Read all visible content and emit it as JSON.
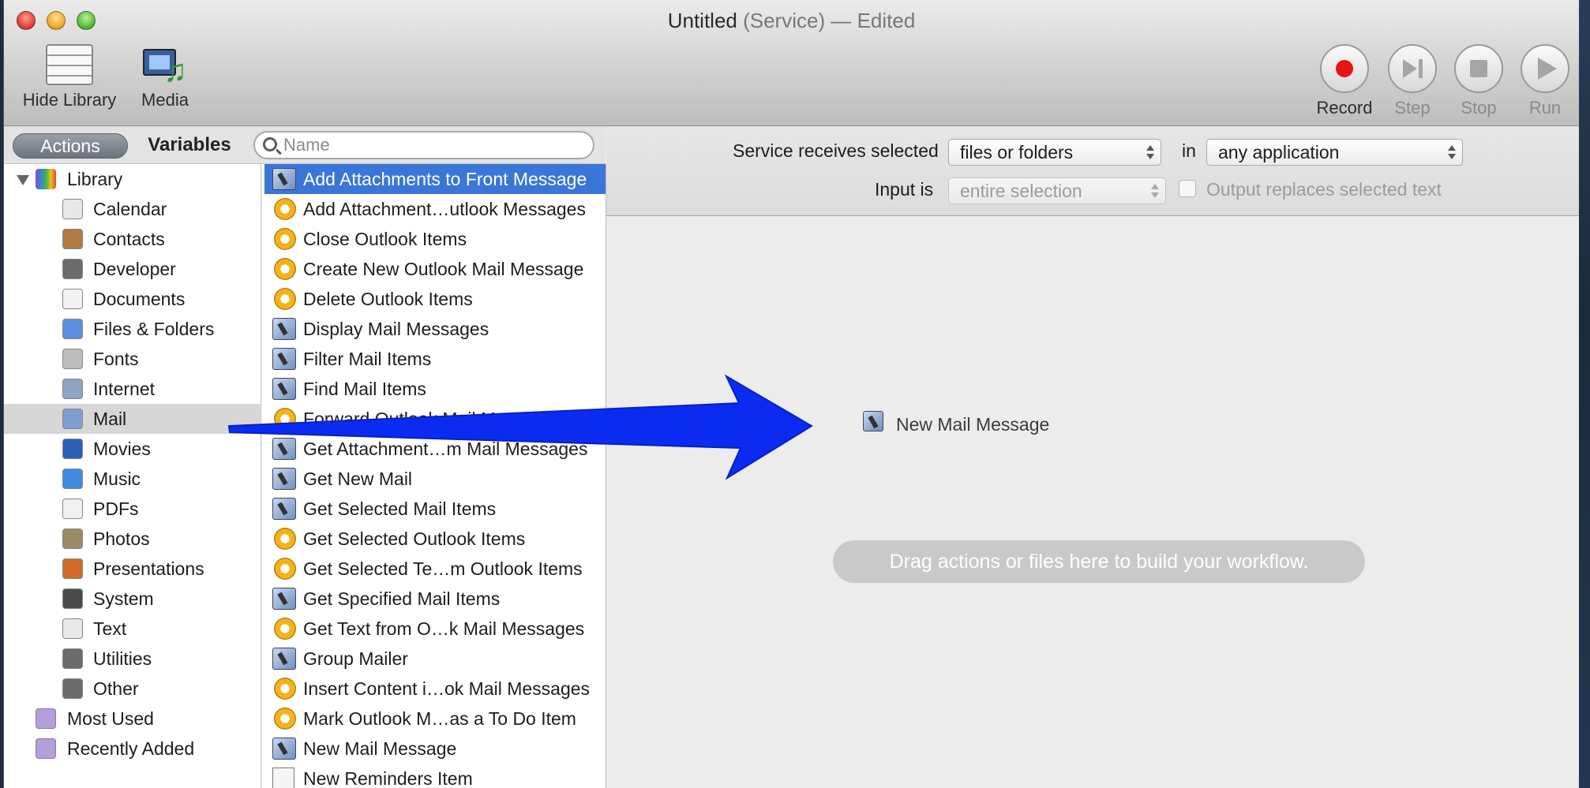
{
  "window": {
    "title_main": "Untitled",
    "title_type": "(Service)",
    "title_state": "— Edited"
  },
  "toolbar": {
    "hide_library": "Hide Library",
    "media": "Media",
    "record": "Record",
    "step": "Step",
    "stop": "Stop",
    "run": "Run"
  },
  "library_header": {
    "actions": "Actions",
    "variables": "Variables",
    "search_placeholder": "Name"
  },
  "library": {
    "root": "Library",
    "categories": [
      "Calendar",
      "Contacts",
      "Developer",
      "Documents",
      "Files & Folders",
      "Fonts",
      "Internet",
      "Mail",
      "Movies",
      "Music",
      "PDFs",
      "Photos",
      "Presentations",
      "System",
      "Text",
      "Utilities",
      "Other"
    ],
    "selected_category": "Mail",
    "most_used": "Most Used",
    "recently_added": "Recently Added"
  },
  "actions": [
    {
      "label": "Add Attachments to Front Message",
      "icon": "mail-icon"
    },
    {
      "label": "Add Attachment…utlook Messages",
      "icon": "outlook-icon"
    },
    {
      "label": "Close Outlook Items",
      "icon": "outlook-icon"
    },
    {
      "label": "Create New Outlook Mail Message",
      "icon": "outlook-icon"
    },
    {
      "label": "Delete Outlook Items",
      "icon": "outlook-icon"
    },
    {
      "label": "Display Mail Messages",
      "icon": "mail-icon"
    },
    {
      "label": "Filter Mail Items",
      "icon": "mail-icon"
    },
    {
      "label": "Find Mail Items",
      "icon": "mail-icon"
    },
    {
      "label": "Forward Outlook Mail Messages",
      "icon": "outlook-icon"
    },
    {
      "label": "Get Attachment…m Mail Messages",
      "icon": "mail-icon"
    },
    {
      "label": "Get New Mail",
      "icon": "mail-icon"
    },
    {
      "label": "Get Selected Mail Items",
      "icon": "mail-icon"
    },
    {
      "label": "Get Selected Outlook Items",
      "icon": "outlook-icon"
    },
    {
      "label": "Get Selected Te…m Outlook Items",
      "icon": "outlook-icon"
    },
    {
      "label": "Get Specified Mail Items",
      "icon": "mail-icon"
    },
    {
      "label": "Get Text from O…k Mail Messages",
      "icon": "outlook-icon"
    },
    {
      "label": "Group Mailer",
      "icon": "mail-icon"
    },
    {
      "label": "Insert Content i…ok Mail Messages",
      "icon": "outlook-icon"
    },
    {
      "label": "Mark Outlook M…as a To Do Item",
      "icon": "outlook-icon"
    },
    {
      "label": "New Mail Message",
      "icon": "mail-icon"
    },
    {
      "label": "New Reminders Item",
      "icon": "note-icon"
    }
  ],
  "selected_action_index": 0,
  "service": {
    "receives_label": "Service receives selected",
    "receives_value": "files or folders",
    "in_label": "in",
    "app_value": "any application",
    "input_label": "Input is",
    "input_value": "entire selection",
    "output_label": "Output replaces selected text"
  },
  "workflow": {
    "dragged_item": "New Mail Message",
    "hint": "Drag actions or files here to build your workflow."
  },
  "colors": {
    "selection": "#3a76d8",
    "arrow": "#0b2cf0",
    "record": "#e41515"
  }
}
